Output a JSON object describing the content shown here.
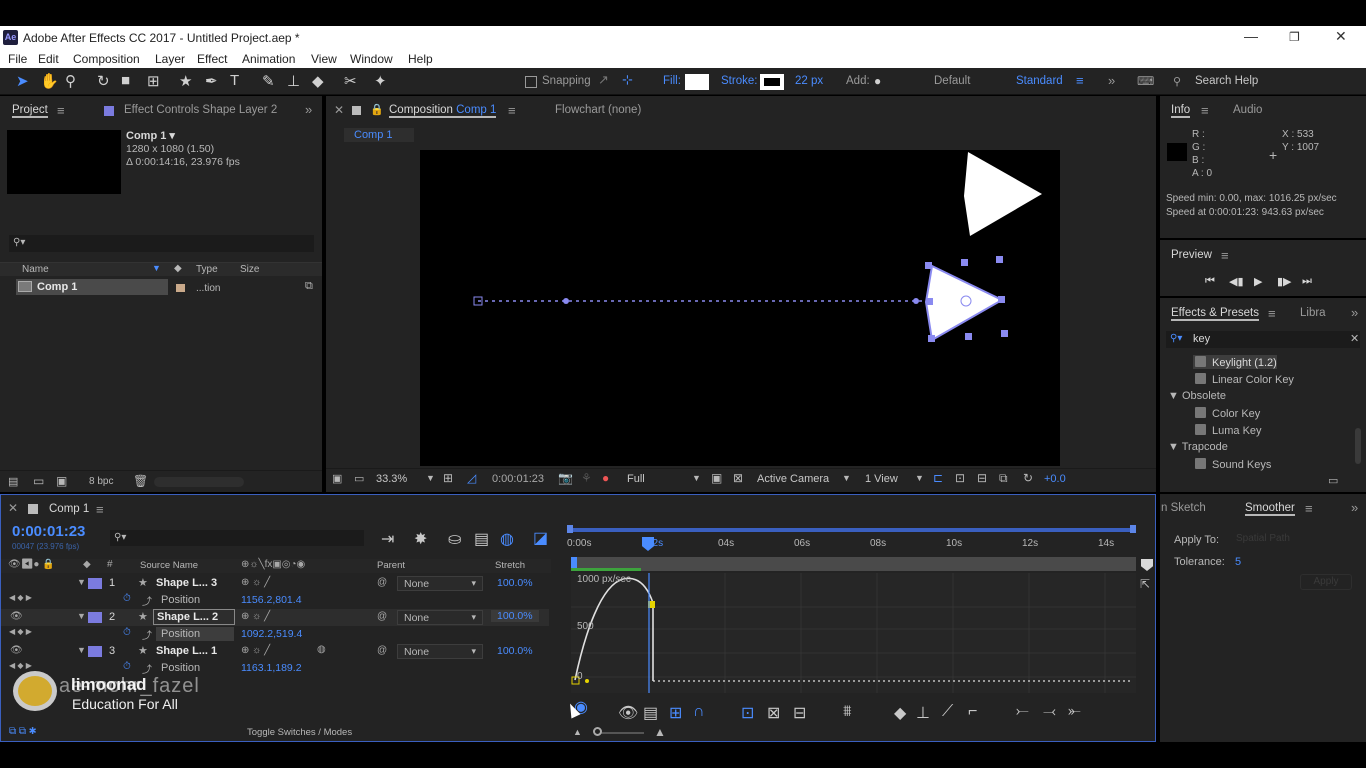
{
  "app": {
    "title": "Adobe After Effects CC 2017 - Untitled Project.aep *",
    "logo": "Ae"
  },
  "menu": [
    "File",
    "Edit",
    "Composition",
    "Layer",
    "Effect",
    "Animation",
    "View",
    "Window",
    "Help"
  ],
  "toolbar": {
    "snapping": "Snapping",
    "fill": "Fill:",
    "stroke": "Stroke:",
    "stroke_px": "22 px",
    "add": "Add:",
    "workspace_default": "Default",
    "workspace_standard": "Standard",
    "search": "Search Help"
  },
  "project": {
    "tab_project": "Project",
    "tab_effect_controls": "Effect Controls Shape Layer 2",
    "comp_name": "Comp 1 ▾",
    "comp_size": "1280 x 1080 (1.50)",
    "comp_duration": "Δ 0:00:14:16, 23.976 fps",
    "col_name": "Name",
    "col_type": "Type",
    "col_size": "Size",
    "item_name": "Comp 1",
    "item_type": "...tion",
    "bpc": "8 bpc"
  },
  "composition": {
    "tab": "Composition",
    "tab_comp": "Comp 1",
    "flowchart": "Flowchart (none)",
    "breadcrumb": "Comp 1",
    "zoom": "33.3%",
    "timecode": "0:00:01:23",
    "resolution": "Full",
    "camera": "Active Camera",
    "views": "1 View",
    "exposure": "+0.0"
  },
  "info": {
    "tab_info": "Info",
    "tab_audio": "Audio",
    "r": "R :",
    "g": "G :",
    "b": "B :",
    "a": "A : 0",
    "x": "X : 533",
    "y": "Y : 1007",
    "speed1": "Speed min: 0.00, max: 1016.25 px/sec",
    "speed2": "Speed at 0:00:01:23: 943.63 px/sec"
  },
  "preview": {
    "title": "Preview"
  },
  "effects": {
    "tab": "Effects & Presets",
    "tab_libraries": "Libra",
    "search_value": "key",
    "items": [
      {
        "label": "Keylight (1.2)",
        "kind": "effect"
      },
      {
        "label": "Linear Color Key",
        "kind": "effect"
      },
      {
        "label": "▼ Obsolete",
        "kind": "folder"
      },
      {
        "label": "Color Key",
        "kind": "effect"
      },
      {
        "label": "Luma Key",
        "kind": "effect"
      },
      {
        "label": "▼ Trapcode",
        "kind": "folder"
      },
      {
        "label": "Sound Keys",
        "kind": "effect"
      }
    ]
  },
  "smoother": {
    "tab_sketch": "n Sketch",
    "tab_smoother": "Smoother",
    "apply_to": "Apply To:",
    "apply_value": "Spatial Path",
    "tolerance": "Tolerance:",
    "tolerance_value": "5",
    "apply_button": "Apply"
  },
  "timeline": {
    "tab": "Comp 1",
    "timecode": "0:00:01:23",
    "frames": "00047 (23.976 fps)",
    "col_source": "Source Name",
    "col_parent": "Parent",
    "col_stretch": "Stretch",
    "layers": [
      {
        "num": "1",
        "name": "Shape L... 3",
        "parent": "None",
        "stretch": "100.0%",
        "prop": "Position",
        "value": "1156.2,801.4"
      },
      {
        "num": "2",
        "name": "Shape L... 2",
        "parent": "None",
        "stretch": "100.0%",
        "prop": "Position",
        "value": "1092.2,519.4"
      },
      {
        "num": "3",
        "name": "Shape L... 1",
        "parent": "None",
        "stretch": "100.0%",
        "prop": "Position",
        "value": "1163.1,189.2"
      }
    ],
    "ruler": [
      "0:00s",
      "02s",
      "04s",
      "06s",
      "08s",
      "10s",
      "12s",
      "14s"
    ],
    "graph_labels": [
      "1000 px/sec",
      "500",
      "0"
    ],
    "toggle": "Toggle Switches / Modes"
  },
  "watermark": {
    "brand": "limoonad",
    "tagline": "Education For All",
    "credit": "ae-mohr_fazel"
  }
}
